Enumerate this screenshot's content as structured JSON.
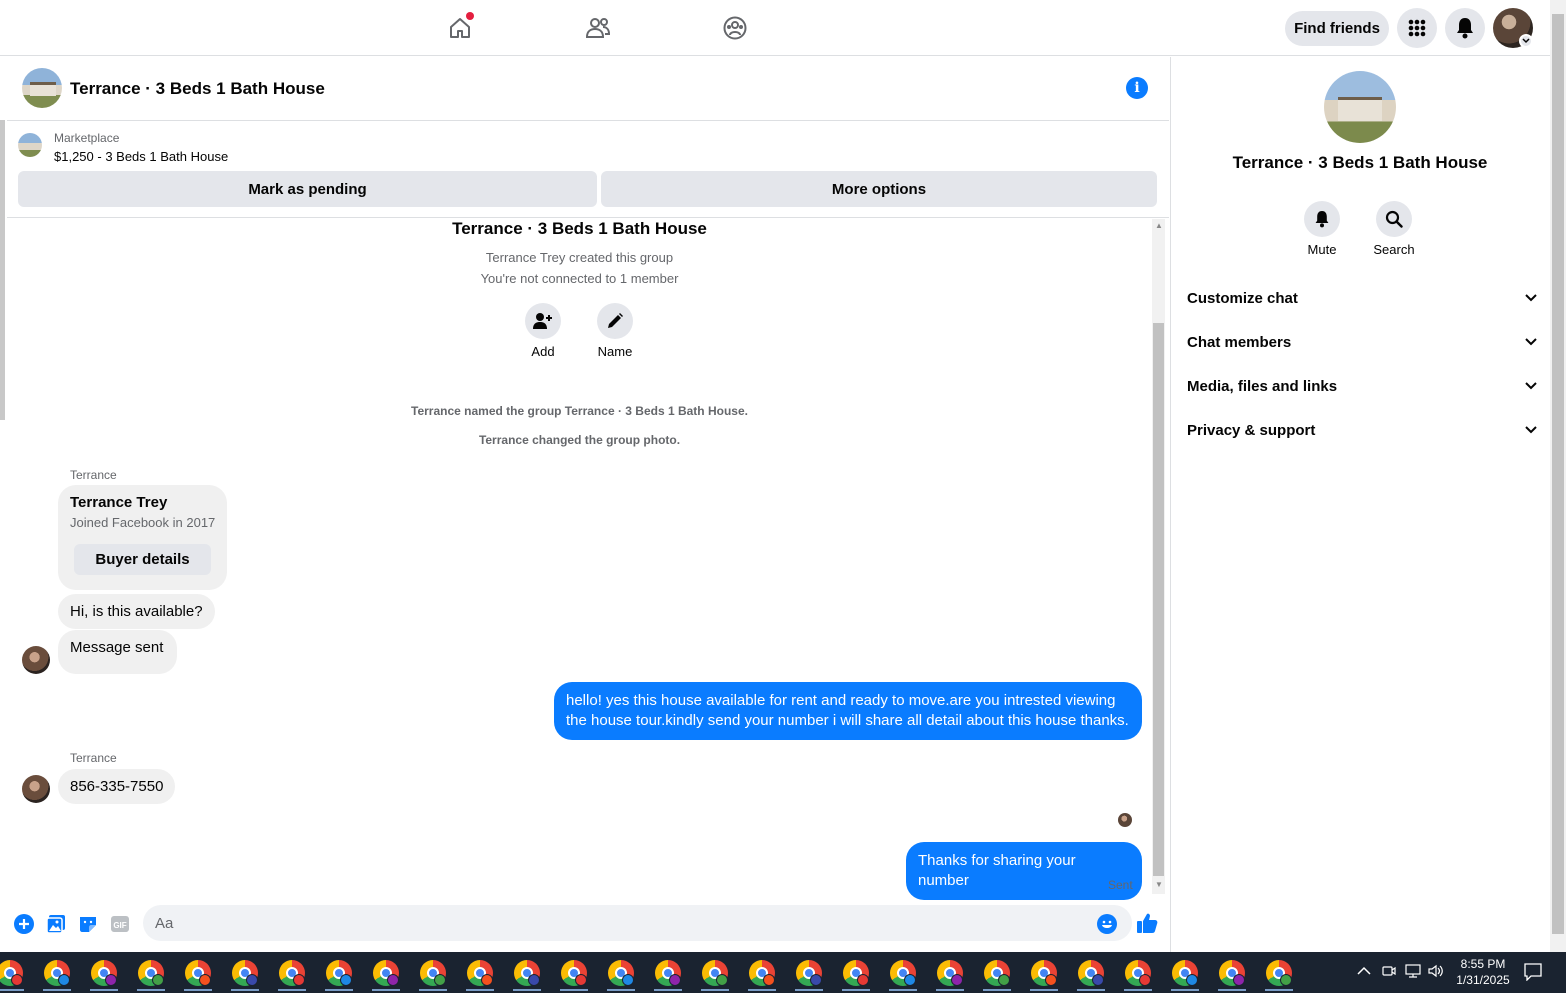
{
  "nav": {
    "find_friends": "Find friends"
  },
  "chat": {
    "title": "Terrance · 3 Beds 1 Bath House"
  },
  "marketplace": {
    "label": "Marketplace",
    "listing": "$1,250 - 3 Beds 1 Bath House",
    "mark_pending": "Mark as pending",
    "more_options": "More options"
  },
  "group_intro": {
    "title": "Terrance · 3 Beds 1 Bath House",
    "created_by": "Terrance Trey created this group",
    "connection": "You're not connected to 1 member",
    "add_label": "Add",
    "name_label": "Name"
  },
  "system_messages": [
    "Terrance named the group Terrance · 3 Beds 1 Bath House.",
    "Terrance changed the group photo."
  ],
  "messages": {
    "sender1": "Terrance",
    "card_name": "Terrance Trey",
    "card_sub": "Joined Facebook in 2017",
    "card_button": "Buyer details",
    "msg1": "Hi, is this available?",
    "msg2": "Message sent",
    "out1_line1": "hello! yes this house available for rent and ready to move.are you intrested viewing",
    "out1_line2": "the house tour.kindly send your number i will share all detail about this house thanks.",
    "sender2": "Terrance",
    "msg3": "856-335-7550",
    "out2": "Thanks for sharing your number",
    "status": "Sent"
  },
  "composer": {
    "placeholder": "Aa"
  },
  "right_panel": {
    "title": "Terrance · 3 Beds 1 Bath House",
    "mute_label": "Mute",
    "search_label": "Search",
    "sections": [
      "Customize chat",
      "Chat members",
      "Media, files and links",
      "Privacy & support"
    ]
  },
  "taskbar": {
    "time": "8:55 PM",
    "date": "1/31/2025",
    "app_count": 28
  },
  "colors": {
    "accent": "#0a7cff",
    "bubble_in": "#f0f0f0",
    "button_gray": "#e4e6eb",
    "notification": "#e41e3f"
  }
}
